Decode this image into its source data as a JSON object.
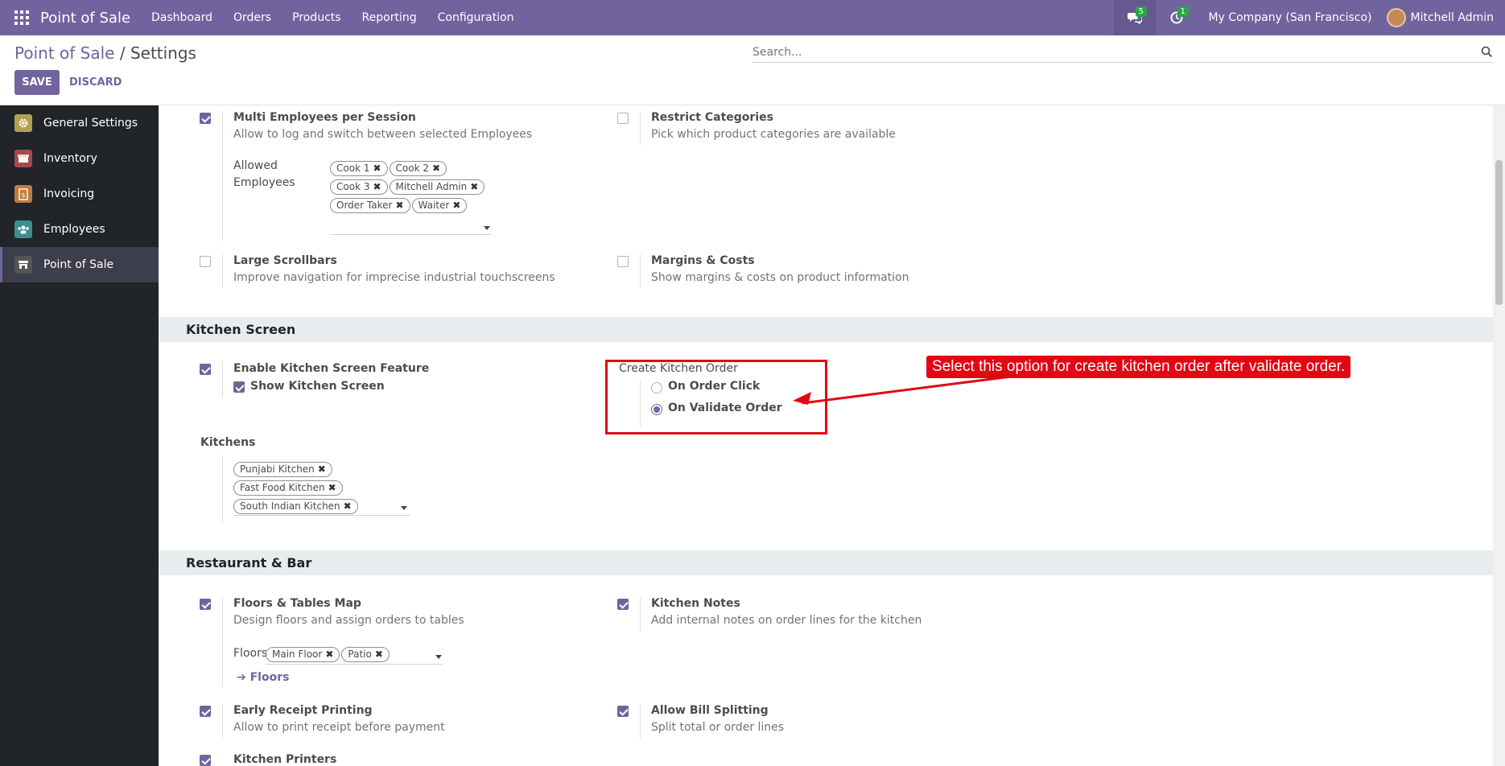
{
  "navbar": {
    "brand": "Point of Sale",
    "menu": [
      "Dashboard",
      "Orders",
      "Products",
      "Reporting",
      "Configuration"
    ],
    "messages_count": "5",
    "activities_count": "1",
    "company": "My Company (San Francisco)",
    "user": "Mitchell Admin"
  },
  "control": {
    "breadcrumb_parent": "Point of Sale",
    "breadcrumb_sep": "/",
    "breadcrumb_current": "Settings",
    "search_placeholder": "Search...",
    "save_label": "SAVE",
    "discard_label": "DISCARD"
  },
  "sidebar": {
    "items": [
      {
        "label": "General Settings",
        "color": "#b2a24d"
      },
      {
        "label": "Inventory",
        "color": "#a54a4a"
      },
      {
        "label": "Invoicing",
        "color": "#c27c3e"
      },
      {
        "label": "Employees",
        "color": "#3e8e8e"
      },
      {
        "label": "Point of Sale",
        "color": "#555"
      }
    ]
  },
  "settings": {
    "multi_employees": {
      "title": "Multi Employees per Session",
      "desc": "Allow to log and switch between selected Employees",
      "checked": true
    },
    "allowed_employees_label_1": "Allowed",
    "allowed_employees_label_2": "Employees",
    "allowed_employees": [
      "Cook 1",
      "Cook 2",
      "Cook 3",
      "Mitchell Admin",
      "Order Taker",
      "Waiter"
    ],
    "restrict_categories": {
      "title": "Restrict Categories",
      "desc": "Pick which product categories are available",
      "checked": false
    },
    "large_scrollbars": {
      "title": "Large Scrollbars",
      "desc": "Improve navigation for imprecise industrial touchscreens",
      "checked": false
    },
    "margins_costs": {
      "title": "Margins & Costs",
      "desc": "Show margins & costs on product information",
      "checked": false
    }
  },
  "kitchen": {
    "section_title": "Kitchen Screen",
    "enable_title": "Enable Kitchen Screen Feature",
    "show_screen_label": "Show Kitchen Screen",
    "create_order_title": "Create Kitchen Order",
    "radio_options": [
      "On Order Click",
      "On Validate Order"
    ],
    "selected_option": "On Validate Order",
    "kitchens_label": "Kitchens",
    "kitchens": [
      "Punjabi Kitchen",
      "Fast Food Kitchen",
      "South Indian Kitchen"
    ]
  },
  "annotation": {
    "callout_text": "Select this option for create kitchen order after validate order.",
    "color": "#e30613"
  },
  "restaurant": {
    "section_title": "Restaurant & Bar",
    "floors_tables": {
      "title": "Floors & Tables Map",
      "desc": "Design floors and assign orders to tables"
    },
    "floors_label": "Floors",
    "floors": [
      "Main Floor",
      "Patio"
    ],
    "floors_link": "Floors",
    "kitchen_notes": {
      "title": "Kitchen Notes",
      "desc": "Add internal notes on order lines for the kitchen"
    },
    "early_receipt": {
      "title": "Early Receipt Printing",
      "desc": "Allow to print receipt before payment"
    },
    "bill_splitting": {
      "title": "Allow Bill Splitting",
      "desc": "Split total or order lines"
    },
    "kitchen_printers": {
      "title": "Kitchen Printers"
    }
  },
  "colors": {
    "primary": "#71639e",
    "annotation": "#e30613"
  }
}
